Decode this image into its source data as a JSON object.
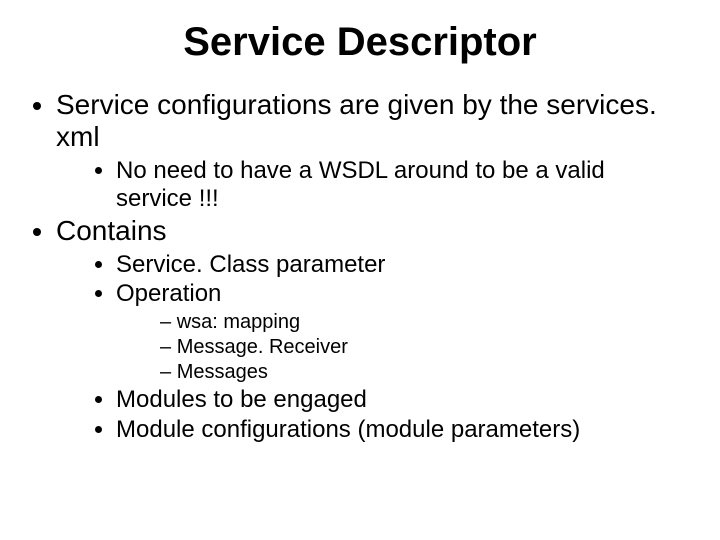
{
  "title": "Service Descriptor",
  "b1": {
    "text": "Service configurations are given by the services. xml",
    "sub": {
      "a": "No need to have a WSDL around to be a valid service !!!"
    }
  },
  "b2": {
    "text": "Contains",
    "sub": {
      "a": "Service. Class parameter",
      "b": "Operation",
      "b_sub": {
        "i": "wsa: mapping",
        "ii": "Message. Receiver",
        "iii": "Messages"
      },
      "c": "Modules to be engaged",
      "d": "Module configurations (module parameters)"
    }
  }
}
